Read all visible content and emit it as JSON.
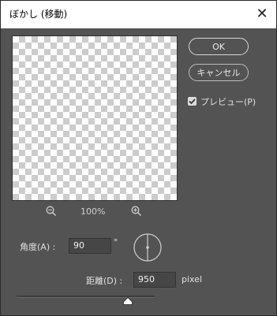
{
  "window": {
    "title": "ぼかし (移動)",
    "close_glyph": "✕"
  },
  "buttons": {
    "ok": "OK",
    "cancel": "キャンセル"
  },
  "preview_toggle": {
    "label": "プレビュー(P)",
    "checked": true
  },
  "zoom": {
    "level": "100%"
  },
  "angle": {
    "label": "角度(A) :",
    "value": "90",
    "unit": "°"
  },
  "distance": {
    "label": "距離(D) :",
    "value": "950",
    "unit": "pixel"
  },
  "colors": {
    "dialog_bg": "#535353",
    "titlebar_bg": "#ffffff",
    "field_bg": "#464646",
    "text": "#e0e0e0"
  }
}
